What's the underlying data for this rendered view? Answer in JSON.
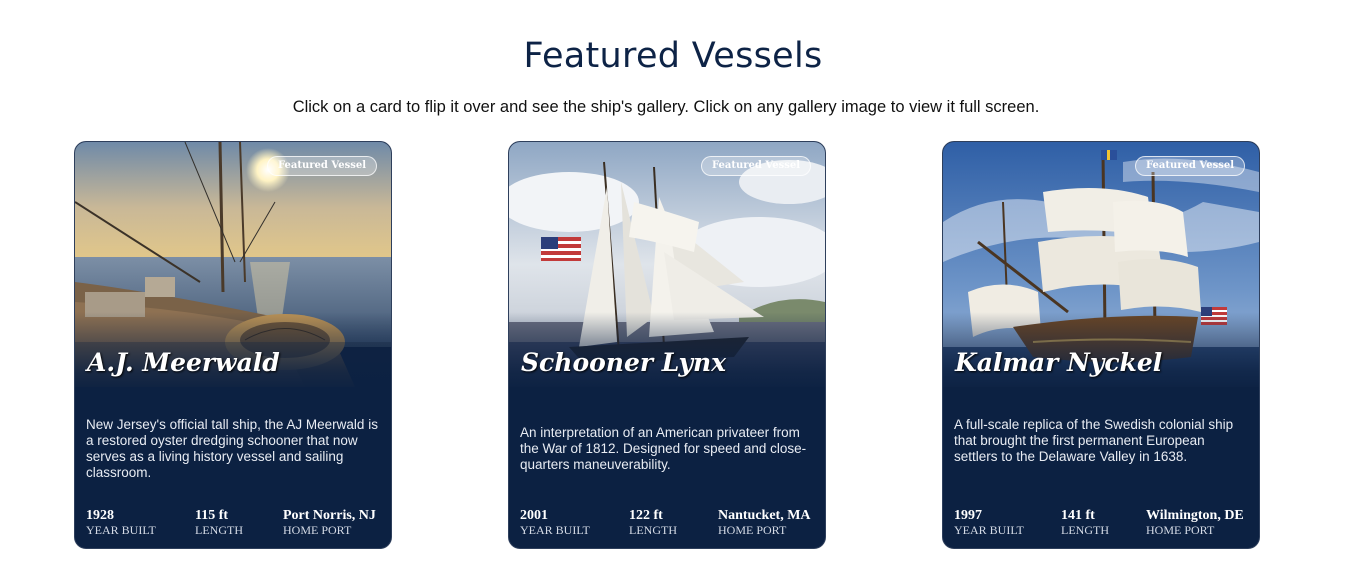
{
  "page": {
    "title": "Featured Vessels",
    "instructions": "Click on a card to flip it over and see the ship's gallery. Click on any gallery image to view it full screen."
  },
  "cards": [
    {
      "badge": "Featured Vessel",
      "name": "A.J. Meerwald",
      "description": "New Jersey's official tall ship, the AJ Meerwald is a restored oyster dredging schooner that now serves as a living history vessel and sailing classroom.",
      "year": "1928",
      "year_label": "YEAR BUILT",
      "length": "115 ft",
      "length_label": "LENGTH",
      "port": "Port Norris, NJ",
      "port_label": "HOME PORT"
    },
    {
      "badge": "Featured Vessel",
      "name": "Schooner Lynx",
      "description": "An interpretation of an American privateer from the War of 1812. Designed for speed and close-quarters maneuverability.",
      "year": "2001",
      "year_label": "YEAR BUILT",
      "length": "122 ft",
      "length_label": "LENGTH",
      "port": "Nantucket, MA",
      "port_label": "HOME PORT"
    },
    {
      "badge": "Featured Vessel",
      "name": "Kalmar Nyckel",
      "description": "A full-scale replica of the Swedish colonial ship that brought the first permanent European settlers to the Delaware Valley in 1638.",
      "year": "1997",
      "year_label": "YEAR BUILT",
      "length": "141 ft",
      "length_label": "LENGTH",
      "port": "Wilmington, DE",
      "port_label": "HOME PORT"
    }
  ],
  "colors": {
    "heading": "#0d2346",
    "card_background": "#0c2142"
  }
}
